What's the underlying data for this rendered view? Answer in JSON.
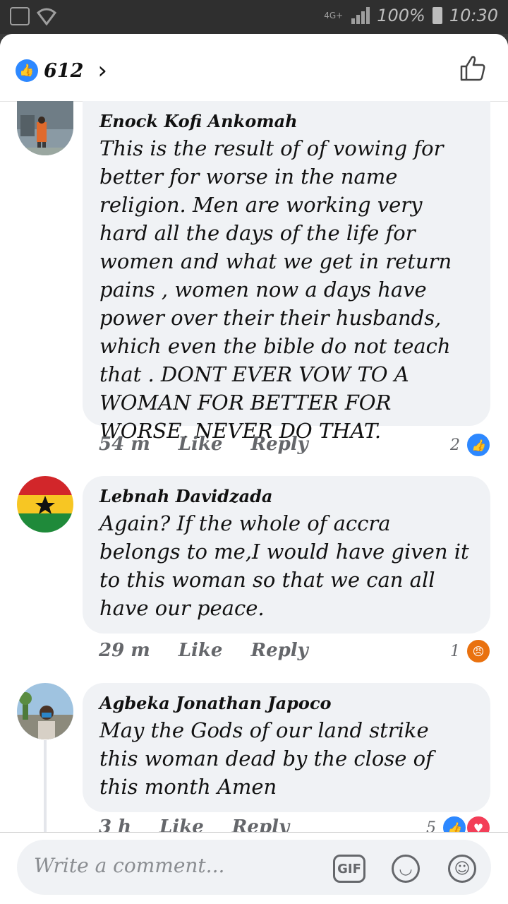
{
  "status_bar": {
    "network": "4G+",
    "battery": "100%",
    "time": "10:30",
    "icons": [
      "image-icon",
      "wifi-icon",
      "signal-icon",
      "battery-icon"
    ]
  },
  "header": {
    "like_count": "612",
    "like_icon": "thumbs-up-icon",
    "chevron": "›",
    "thumb_outline": "👍"
  },
  "comments": [
    {
      "author": "Enock Kofi Ankomah",
      "text": "This is the result of of vowing for better for worse in the name religion. Men are working very hard all the days of the life for women and what we get in return pains , women now a days have power over their their husbands, which even the bible do not teach that . DONT EVER VOW TO A WOMAN FOR BETTER FOR WORSE, NEVER DO THAT.",
      "time": "54 m",
      "like_label": "Like",
      "reply_label": "Reply",
      "reaction_count": "2",
      "reaction_type": "like"
    },
    {
      "author": "Lebnah Davidzada",
      "text": "Again? If the whole of accra belongs to me,I would have given it to this woman so that we can all have our peace.",
      "time": "29 m",
      "like_label": "Like",
      "reply_label": "Reply",
      "reaction_count": "1",
      "reaction_type": "angry"
    },
    {
      "author": "Agbeka Jonathan Japoco",
      "text": "May the Gods of our land strike this woman dead by the close of this month Amen",
      "time": "3 h",
      "like_label": "Like",
      "reply_label": "Reply",
      "reaction_count": "5",
      "reaction_type": "like+love"
    }
  ],
  "composer": {
    "placeholder": "Write a comment...",
    "gif_label": "GIF"
  },
  "colors": {
    "accent": "#2d88ff",
    "bubble": "#f0f2f5",
    "angry": "#e9710f",
    "love": "#f33e58"
  }
}
